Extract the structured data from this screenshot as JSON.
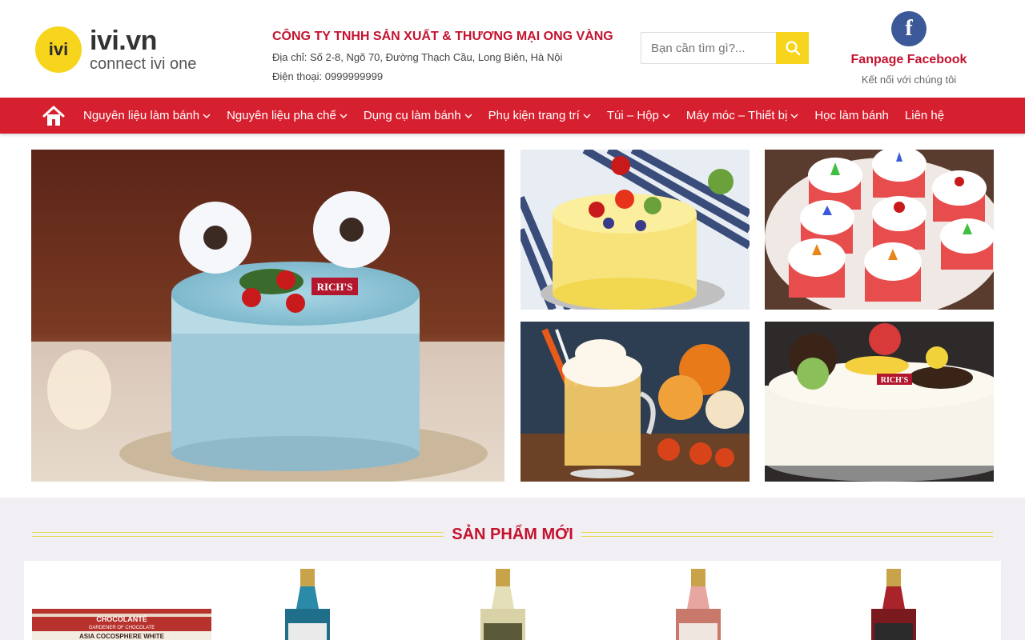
{
  "logo": {
    "mark": "ivi",
    "name": "ivi.vn",
    "tagline": "connect ivi one"
  },
  "company": {
    "name": "CÔNG TY TNHH SẢN XUẤT & THƯƠNG MẠI ONG VÀNG",
    "address": "Địa chỉ: Số 2-8, Ngõ 70, Đường Thạch Cầu, Long Biên, Hà Nội",
    "phone": "Điện thoại: 0999999999"
  },
  "search": {
    "placeholder": "Bạn cần tìm gì?...",
    "icon": "search-icon"
  },
  "facebook": {
    "icon": "facebook-icon",
    "title": "Fanpage Facebook",
    "subtitle": "Kết nối với chúng tôi"
  },
  "nav": {
    "home_icon": "home-icon",
    "items": [
      {
        "label": "Nguyên liệu làm bánh",
        "dropdown": true
      },
      {
        "label": "Nguyên liệu pha chế",
        "dropdown": true
      },
      {
        "label": "Dụng cụ làm bánh",
        "dropdown": true
      },
      {
        "label": "Phụ kiện trang trí",
        "dropdown": true
      },
      {
        "label": "Túi – Hộp",
        "dropdown": true
      },
      {
        "label": "Máy móc – Thiết bị",
        "dropdown": true
      },
      {
        "label": "Học làm bánh",
        "dropdown": false
      },
      {
        "label": "Liên hệ",
        "dropdown": false
      }
    ]
  },
  "banner": {
    "main_cake_label": "RICH'S",
    "bottom_right_label": "RICH'S"
  },
  "products_section": {
    "title": "SẢN PHẨM MỚI",
    "first_product_label_1": "CHOCOLANTÉ",
    "first_product_label_2": "GARDENER OF CHOCOLATE",
    "first_product_label_3": "ASIA COCOSPHERE WHITE"
  },
  "colors": {
    "brand_red": "#d7202f",
    "brand_yellow": "#f7d51d",
    "facebook_blue": "#3b5998"
  }
}
